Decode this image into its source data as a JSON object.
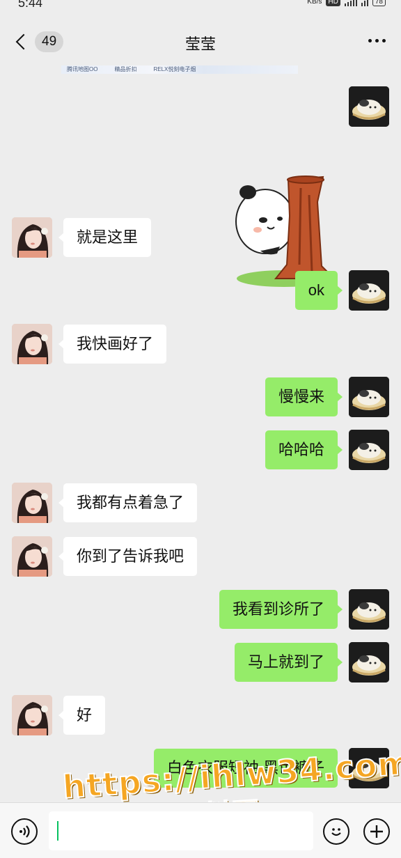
{
  "status_bar": {
    "time": "5:44",
    "speed": "KB/s",
    "network_badge": "HD",
    "battery": "78"
  },
  "header": {
    "back_count": "49",
    "title": "莹莹"
  },
  "top_strip": [
    "腾讯地图OO",
    "精品折扣",
    "RELX悦刻电子烟"
  ],
  "messages": [
    {
      "side": "left",
      "text": "就是这里"
    },
    {
      "side": "right",
      "text": "ok"
    },
    {
      "side": "left",
      "text": "我快画好了"
    },
    {
      "side": "right",
      "text": "慢慢来"
    },
    {
      "side": "right",
      "text": "哈哈哈"
    },
    {
      "side": "left",
      "text": "我都有点着急了"
    },
    {
      "side": "left",
      "text": "你到了告诉我吧"
    },
    {
      "side": "right",
      "text": "我看到诊所了"
    },
    {
      "side": "right",
      "text": "马上就到了"
    },
    {
      "side": "left",
      "text": "好"
    },
    {
      "side": "right",
      "text": "白色衣服短袖  黑色裤子"
    }
  ],
  "sticker": {
    "description_icon": "panda-behind-tree-sticker"
  },
  "watermark": {
    "line1": "https://ihlw34.com",
    "line2": "黑料网"
  },
  "colors": {
    "me_bubble": "#95ec69",
    "other_bubble": "#ffffff",
    "background": "#ededed"
  }
}
